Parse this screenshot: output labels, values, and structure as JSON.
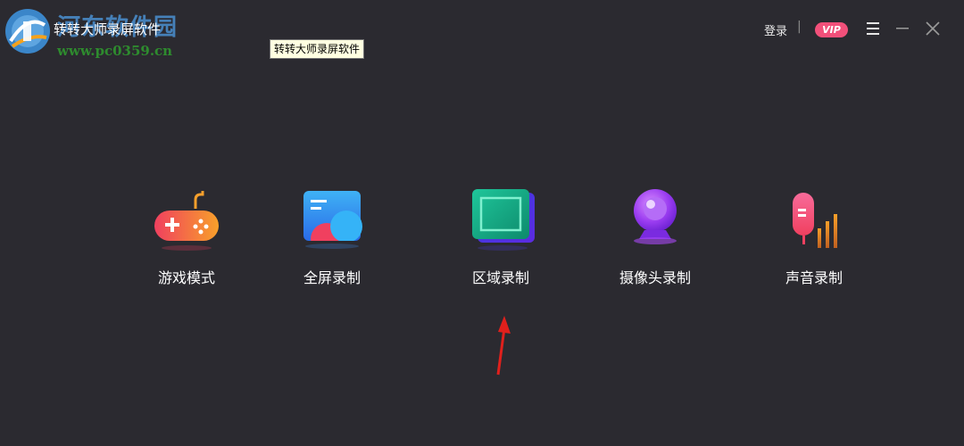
{
  "window": {
    "title": "转转大师录屏软件",
    "tooltip": "转转大师录屏软件"
  },
  "watermark": {
    "site_name": "河东软件园",
    "url": "www.pc0359.cn"
  },
  "header": {
    "login_label": "登录",
    "separator": "|",
    "vip_label": "VIP"
  },
  "icons": {
    "menu": "hamburger-menu-icon",
    "minimize": "minimize-icon",
    "close": "close-icon",
    "annotation": "red-arrow-annotation"
  },
  "modes": [
    {
      "label": "游戏模式",
      "icon": "gamepad-icon"
    },
    {
      "label": "全屏录制",
      "icon": "fullscreen-icon"
    },
    {
      "label": "区域录制",
      "icon": "region-icon"
    },
    {
      "label": "摄像头录制",
      "icon": "webcam-icon"
    },
    {
      "label": "声音录制",
      "icon": "microphone-icon"
    }
  ],
  "colors": {
    "background": "#2b2a30",
    "vip": "#f2507a",
    "annotation_arrow": "#e0201c"
  }
}
